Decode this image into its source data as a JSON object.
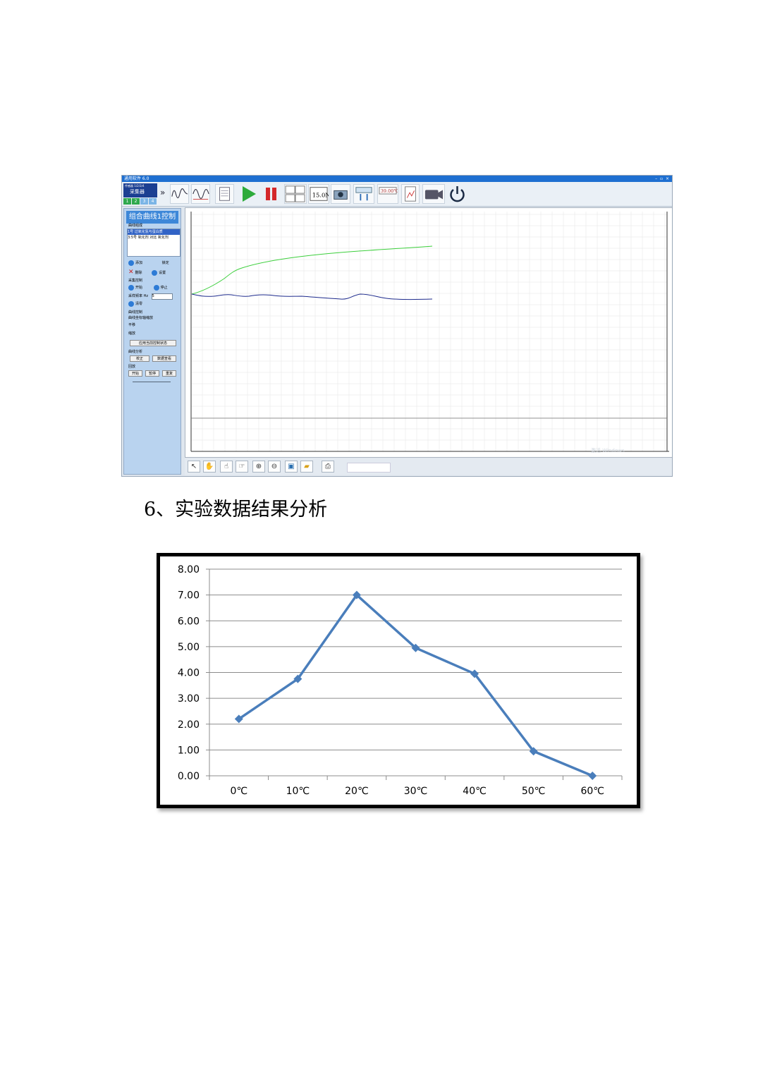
{
  "app": {
    "title": "通用软件 6.0",
    "window_controls": "– ▫ ×",
    "collector": {
      "header": "传感器 1/2/3/4",
      "name": "采集器",
      "channels": [
        "1",
        "2",
        "3",
        "4"
      ]
    },
    "panel": {
      "title": "组合曲线1控制",
      "list_label": "曲线组成",
      "list_items": [
        "1号 过氧化氢与蛋白质",
        "3:5号 氧化剂 对比 氧化剂"
      ],
      "add": "添加",
      "lock": "锁定",
      "delete": "删除",
      "settings": "设置",
      "sample_control": "采集控制",
      "start": "开始",
      "stop": "停止",
      "sample_rate_label": "采样频率 Hz",
      "sample_rate_value": "5",
      "clear": "清零",
      "curve_control": "曲线控制",
      "curve_option": "曲线坐标轴缩放",
      "translate": "平移",
      "zoom": "缩放",
      "confirm": "应用当前控制状态",
      "analysis": "曲线分析",
      "analysis_btn1": "校正",
      "analysis_btn2": "数据查看",
      "play_label": "回放",
      "play": "开始",
      "pause": "暂停",
      "replay": "重复"
    },
    "watermark": "激活 Windows"
  },
  "section_heading": "6、实验数据结果分析",
  "chart_data": {
    "type": "line",
    "categories": [
      "0℃",
      "10℃",
      "20℃",
      "30℃",
      "40℃",
      "50℃",
      "60℃"
    ],
    "series": [
      {
        "values": [
          2.2,
          3.75,
          7.0,
          4.95,
          3.95,
          0.95,
          0.0
        ],
        "color": "#4a7ebb"
      }
    ],
    "y_ticks": [
      "0.00",
      "1.00",
      "2.00",
      "3.00",
      "4.00",
      "5.00",
      "6.00",
      "7.00",
      "8.00"
    ],
    "ylim": [
      0,
      8
    ],
    "grid": true,
    "legend": "none"
  }
}
